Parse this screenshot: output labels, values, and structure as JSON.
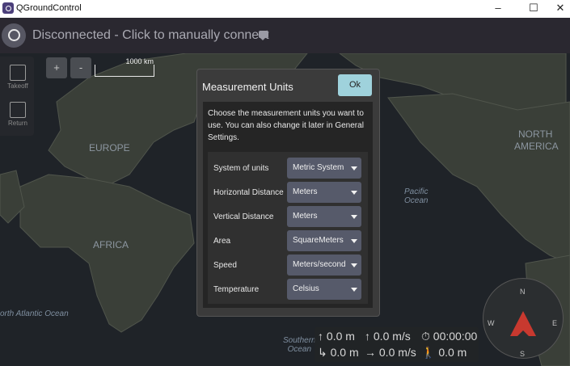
{
  "window": {
    "title": "QGroundControl",
    "minimize": "–",
    "maximize": "☐",
    "close": "✕"
  },
  "toolbar": {
    "connection_status": "Disconnected - Click to manually connect"
  },
  "side_toolbar": {
    "takeoff": "Takeoff",
    "return": "Return"
  },
  "map": {
    "zoom_in": "+",
    "zoom_out": "-",
    "scale_label": "1000 km",
    "labels": {
      "europe": "EUROPE",
      "africa": "AFRICA",
      "north": "NORTH",
      "america": "AMERICA"
    },
    "oceans": {
      "pacific_1": "Pacific",
      "pacific_2": "Ocean",
      "north_atlantic": "orth Atlantic Ocean",
      "southern_1": "Southern",
      "southern_2": "Ocean"
    }
  },
  "dialog": {
    "title": "Measurement Units",
    "ok": "Ok",
    "intro": "Choose the measurement units you want to use. You can also change it later in General Settings.",
    "rows": [
      {
        "label": "System of units",
        "value": "Metric System"
      },
      {
        "label": "Horizontal Distance",
        "value": "Meters"
      },
      {
        "label": "Vertical Distance",
        "value": "Meters"
      },
      {
        "label": "Area",
        "value": "SquareMeters"
      },
      {
        "label": "Speed",
        "value": "Meters/second"
      },
      {
        "label": "Temperature",
        "value": "Celsius"
      }
    ]
  },
  "telemetry": {
    "altitude_relative": "↑ 0.0 m",
    "vertical_speed": "↑ 0.0 m/s",
    "flight_time": "⏱ 00:00:00",
    "distance_home": "↳ 0.0 m",
    "ground_speed": "→ 0.0 m/s",
    "distance_to_ground": "🚶 0.0 m"
  },
  "compass": {
    "n": "N",
    "e": "E",
    "s": "S",
    "w": "W"
  }
}
